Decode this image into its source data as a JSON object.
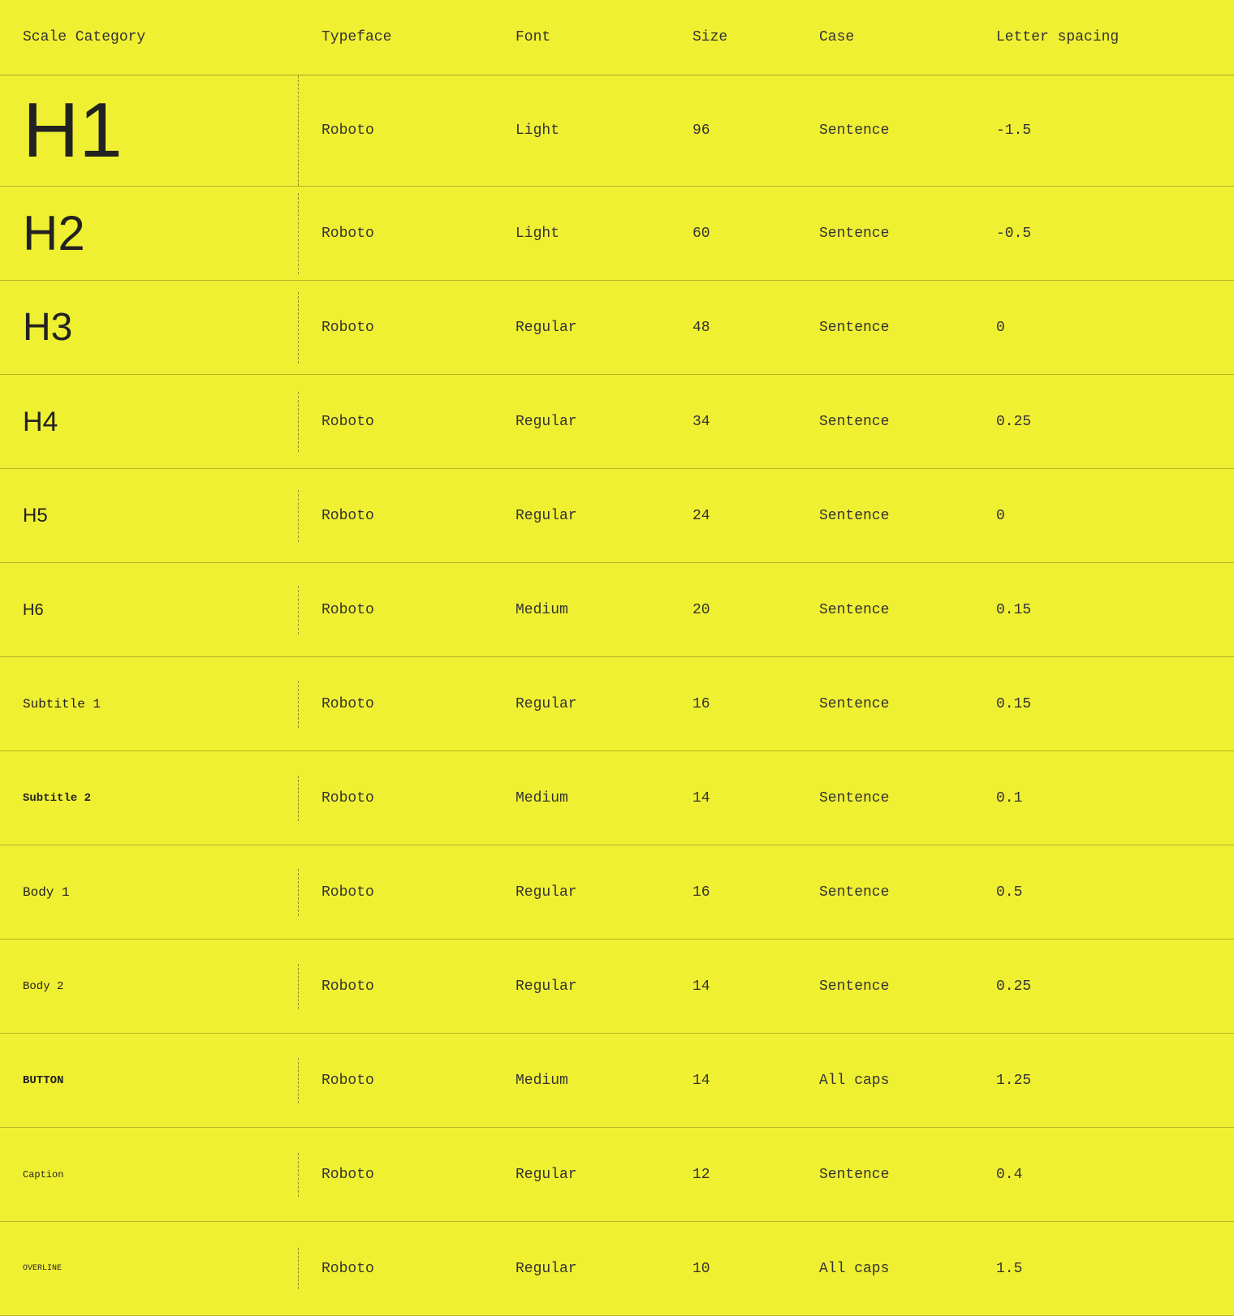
{
  "header": {
    "columns": [
      {
        "id": "scale-category",
        "label": "Scale Category"
      },
      {
        "id": "typeface",
        "label": "Typeface"
      },
      {
        "id": "font",
        "label": "Font"
      },
      {
        "id": "size",
        "label": "Size"
      },
      {
        "id": "case",
        "label": "Case"
      },
      {
        "id": "letter-spacing",
        "label": "Letter spacing"
      }
    ]
  },
  "rows": [
    {
      "scale": "H1",
      "scaleClass": "h1-label",
      "typeface": "Roboto",
      "font": "Light",
      "size": "96",
      "case": "Sentence",
      "letterSpacing": "-1.5"
    },
    {
      "scale": "H2",
      "scaleClass": "h2-label",
      "typeface": "Roboto",
      "font": "Light",
      "size": "60",
      "case": "Sentence",
      "letterSpacing": "-0.5"
    },
    {
      "scale": "H3",
      "scaleClass": "h3-label",
      "typeface": "Roboto",
      "font": "Regular",
      "size": "48",
      "case": "Sentence",
      "letterSpacing": "0"
    },
    {
      "scale": "H4",
      "scaleClass": "h4-label",
      "typeface": "Roboto",
      "font": "Regular",
      "size": "34",
      "case": "Sentence",
      "letterSpacing": "0.25"
    },
    {
      "scale": "H5",
      "scaleClass": "h5-label",
      "typeface": "Roboto",
      "font": "Regular",
      "size": "24",
      "case": "Sentence",
      "letterSpacing": "0"
    },
    {
      "scale": "H6",
      "scaleClass": "h6-label",
      "typeface": "Roboto",
      "font": "Medium",
      "size": "20",
      "case": "Sentence",
      "letterSpacing": "0.15"
    },
    {
      "scale": "Subtitle 1",
      "scaleClass": "subtitle1-label",
      "typeface": "Roboto",
      "font": "Regular",
      "size": "16",
      "case": "Sentence",
      "letterSpacing": "0.15"
    },
    {
      "scale": "Subtitle 2",
      "scaleClass": "subtitle2-label",
      "typeface": "Roboto",
      "font": "Medium",
      "size": "14",
      "case": "Sentence",
      "letterSpacing": "0.1"
    },
    {
      "scale": "Body 1",
      "scaleClass": "body1-label",
      "typeface": "Roboto",
      "font": "Regular",
      "size": "16",
      "case": "Sentence",
      "letterSpacing": "0.5"
    },
    {
      "scale": "Body 2",
      "scaleClass": "body2-label",
      "typeface": "Roboto",
      "font": "Regular",
      "size": "14",
      "case": "Sentence",
      "letterSpacing": "0.25"
    },
    {
      "scale": "BUTTON",
      "scaleClass": "button-label",
      "typeface": "Roboto",
      "font": "Medium",
      "size": "14",
      "case": "All caps",
      "letterSpacing": "1.25"
    },
    {
      "scale": "Caption",
      "scaleClass": "caption-label",
      "typeface": "Roboto",
      "font": "Regular",
      "size": "12",
      "case": "Sentence",
      "letterSpacing": "0.4"
    },
    {
      "scale": "OVERLINE",
      "scaleClass": "overline-label",
      "typeface": "Roboto",
      "font": "Regular",
      "size": "10",
      "case": "All caps",
      "letterSpacing": "1.5"
    }
  ]
}
